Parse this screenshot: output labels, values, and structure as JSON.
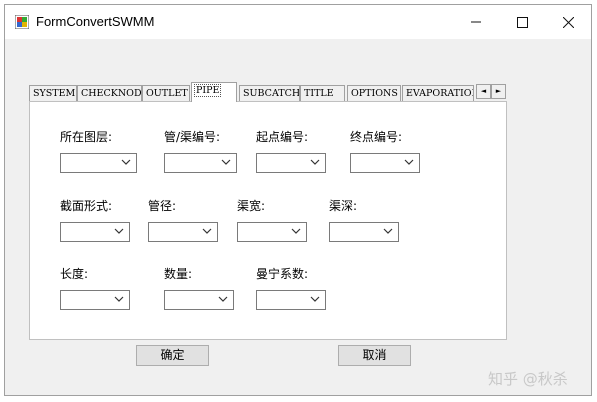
{
  "window": {
    "title": "FormConvertSWMM"
  },
  "tabs": [
    "SYSTEM",
    "CHECKNODE",
    "OUTLET",
    "PIPE",
    "SUBCATCH",
    "TITLE",
    "OPTIONS",
    "EVAPORATION"
  ],
  "active_tab": "PIPE",
  "scroll_buttons": {
    "left": "◄",
    "right": "►"
  },
  "form": {
    "row1": [
      "所在图层:",
      "管/渠编号:",
      "起点编号:",
      "终点编号:"
    ],
    "row2": [
      "截面形式:",
      "管径:",
      "渠宽:",
      "渠深:"
    ],
    "row3": [
      "长度:",
      "数量:",
      "曼宁系数:"
    ]
  },
  "buttons": {
    "ok": "确定",
    "cancel": "取消"
  },
  "watermark": "知乎 @秋杀"
}
